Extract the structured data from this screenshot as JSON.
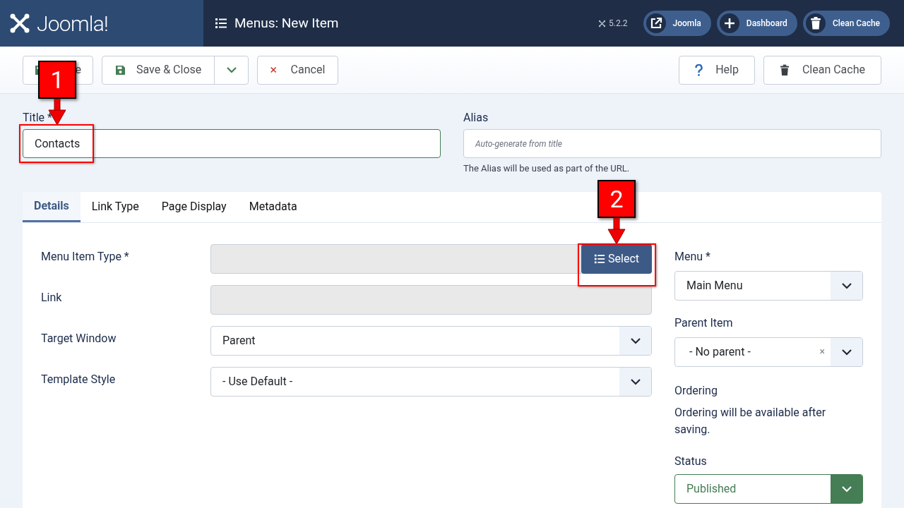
{
  "header": {
    "logo": "Joomla!",
    "title": "Menus: New Item",
    "version": "5.2.2",
    "links": [
      {
        "label": "Joomla",
        "kind": "external"
      },
      {
        "label": "Dashboard",
        "kind": "plus"
      },
      {
        "label": "Clean Cache",
        "kind": "trash"
      }
    ]
  },
  "toolbar": {
    "left": [
      {
        "label": "e",
        "kind": "save"
      },
      {
        "label": "Save & Close",
        "kind": "save-close"
      },
      {
        "label": "Cancel",
        "kind": "cancel"
      }
    ],
    "right": [
      {
        "label": "Help",
        "kind": "help"
      },
      {
        "label": "Clean Cache",
        "kind": "trash"
      }
    ]
  },
  "title_field": {
    "label": "Title *",
    "value": "Contacts"
  },
  "alias_field": {
    "label": "Alias",
    "placeholder": "Auto-generate from title",
    "hint": "The Alias will be used as part of the URL."
  },
  "tabs": [
    {
      "label": "Details",
      "selected": true
    },
    {
      "label": "Link Type",
      "selected": false
    },
    {
      "label": "Page Display",
      "selected": false
    },
    {
      "label": "Metadata",
      "selected": false
    }
  ],
  "fields": [
    {
      "label": "Menu Item Type *",
      "kind": "select-button",
      "button": "Select"
    },
    {
      "label": "Link",
      "kind": "readonly"
    },
    {
      "label": "Target Window",
      "kind": "dropdown",
      "value": "Parent"
    },
    {
      "label": "Template Style",
      "kind": "dropdown",
      "value": "- Use Default -"
    }
  ],
  "side": {
    "menu": {
      "label": "Menu *",
      "value": "Main Menu"
    },
    "parent": {
      "label": "Parent Item",
      "value": "- No parent -",
      "clear": "×"
    },
    "ordering": {
      "label": "Ordering",
      "text": "Ordering will be available after saving."
    },
    "status": {
      "label": "Status",
      "value": "Published"
    }
  },
  "annotations": [
    {
      "label": "1"
    },
    {
      "label": "2"
    }
  ]
}
